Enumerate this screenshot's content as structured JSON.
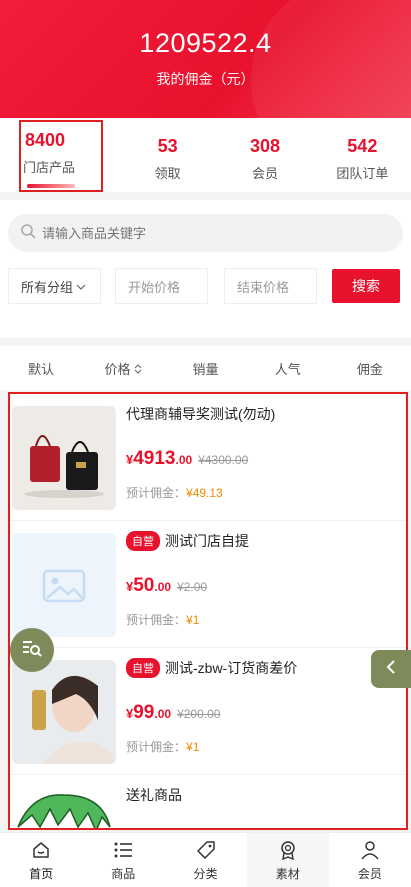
{
  "hero": {
    "amount": "1209522.4",
    "label": "我的佣金（元）"
  },
  "stats": [
    {
      "num": "8400",
      "label": "门店产品"
    },
    {
      "num": "53",
      "label": "领取"
    },
    {
      "num": "308",
      "label": "会员"
    },
    {
      "num": "542",
      "label": "团队订单"
    }
  ],
  "search": {
    "placeholder": "请输入商品关键字"
  },
  "filters": {
    "group": "所有分组",
    "start_price": "开始价格",
    "end_price": "结束价格",
    "button": "搜索"
  },
  "sort": [
    "默认",
    "价格",
    "销量",
    "人气",
    "佣金"
  ],
  "products": [
    {
      "tag": "",
      "title": "代理商辅导奖测试(勿动)",
      "yen": "¥",
      "price_int": "4913",
      "price_dec": ".00",
      "old": "¥4300.00",
      "comm_label": "预计佣金：",
      "comm_value": "¥49.13"
    },
    {
      "tag": "自营",
      "title": "测试门店自提",
      "yen": "¥",
      "price_int": "50",
      "price_dec": ".00",
      "old": "¥2.00",
      "comm_label": "预计佣金：",
      "comm_value": "¥1"
    },
    {
      "tag": "自营",
      "title": "测试-zbw-订货商差价",
      "yen": "¥",
      "price_int": "99",
      "price_dec": ".00",
      "old": "¥200.00",
      "comm_label": "预计佣金：",
      "comm_value": "¥1"
    },
    {
      "tag": "",
      "title": "送礼商品"
    }
  ],
  "tabbar": [
    "首页",
    "商品",
    "分类",
    "素材",
    "会员"
  ],
  "colors": {
    "primary": "#e8122d",
    "commission": "#f08a00",
    "fab": "#7f8a5a"
  }
}
